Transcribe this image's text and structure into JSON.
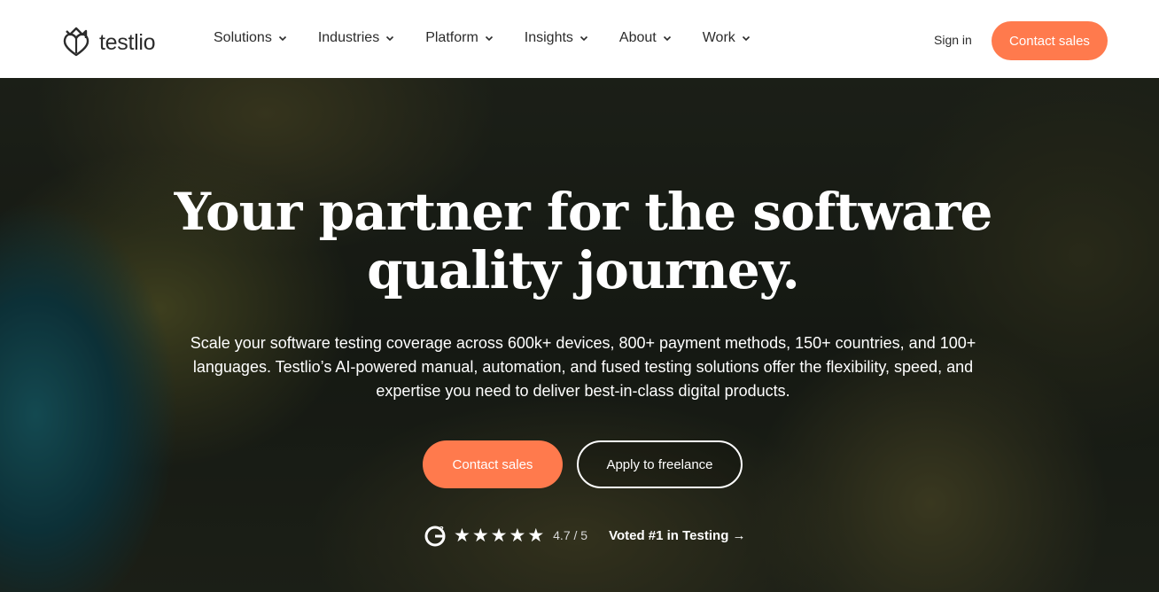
{
  "header": {
    "logo_text": "testlio",
    "nav": [
      {
        "label": "Solutions"
      },
      {
        "label": "Industries"
      },
      {
        "label": "Platform"
      },
      {
        "label": "Insights"
      },
      {
        "label": "About"
      },
      {
        "label": "Work"
      }
    ],
    "signin_label": "Sign in",
    "cta_label": "Contact sales"
  },
  "hero": {
    "headline_line1": "Your partner for the software",
    "headline_line2": "quality journey.",
    "subtext": "Scale your software testing coverage across 600k+ devices, 800+ payment methods, 150+ countries, and 100+ languages. Testlio’s AI-powered manual, automation, and fused testing solutions offer the flexibility, speed, and expertise you need to deliver best-in-class digital products.",
    "primary_cta": "Contact sales",
    "secondary_cta": "Apply to freelance",
    "rating": {
      "stars": 5,
      "score": "4.7 / 5",
      "voted_text": "Voted #1 in Testing →"
    }
  },
  "colors": {
    "accent": "#ff7a4d",
    "text_dark": "#2b2b2b",
    "hero_text": "#ffffff"
  },
  "icons": {
    "logo": "testlio-crown-heart-icon",
    "chevron": "chevron-down-icon",
    "g2": "g2-logo-icon",
    "star": "star-icon"
  }
}
